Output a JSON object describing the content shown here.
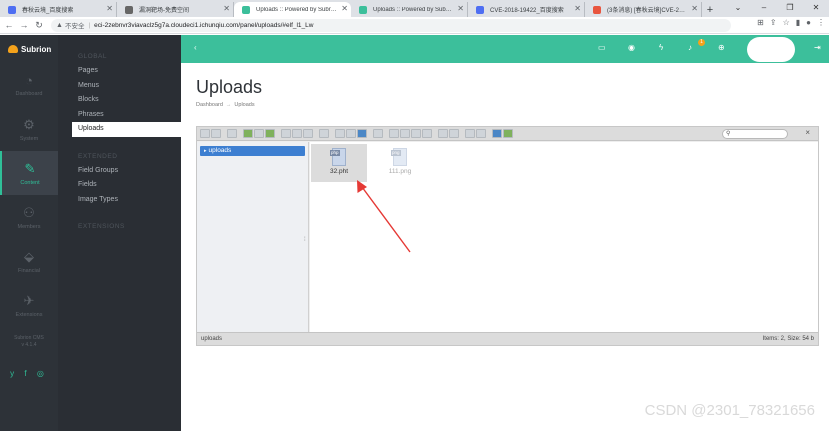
{
  "browser": {
    "tabs": [
      {
        "label": "春秋云境_百度搜索",
        "favicon_color": "#4e6ef2",
        "active": false
      },
      {
        "label": "漏洞靶场-免费空间",
        "favicon_color": "#666666",
        "active": false
      },
      {
        "label": "Uploads :: Powered by Subrion",
        "favicon_color": "#3cbf9b",
        "active": true
      },
      {
        "label": "Uploads :: Powered by Subrion",
        "favicon_color": "#3cbf9b",
        "active": false
      },
      {
        "label": "CVE-2018-19422_百度搜索",
        "favicon_color": "#4e6ef2",
        "active": false
      },
      {
        "label": "(3条消息) [春秋云境]CVE-2018-...",
        "favicon_color": "#e8553e",
        "active": false
      }
    ],
    "insecure_label": "不安全",
    "url": "eci-2zebnvr3viavaclz5g7a.cloudeci1.ichunqiu.com/panel/uploads/#elf_l1_Lw"
  },
  "app": {
    "logo_text": "Subrion",
    "iconbar": [
      {
        "label": "Dashboard",
        "icon": "gauge-icon",
        "glyph": "◔"
      },
      {
        "label": "System",
        "icon": "gear-icon",
        "glyph": "⚙"
      },
      {
        "label": "Content",
        "icon": "pencil-icon",
        "glyph": "✎"
      },
      {
        "label": "Members",
        "icon": "user-icon",
        "glyph": "⚇"
      },
      {
        "label": "Financial",
        "icon": "tag-icon",
        "glyph": "⬙"
      },
      {
        "label": "Extensions",
        "icon": "plug-icon",
        "glyph": "✈"
      }
    ],
    "cms_name": "Subrion CMS",
    "cms_version": "v 4.1.4",
    "socials": "y f ◎",
    "subnav": {
      "global_head": "GLOBAL",
      "global_items": [
        "Pages",
        "Menus",
        "Blocks",
        "Phrases",
        "Uploads"
      ],
      "extended_head": "EXTENDED",
      "extended_items": [
        "Field Groups",
        "Fields",
        "Image Types"
      ],
      "extensions_head": "EXTENSIONS"
    },
    "notification_count": "1"
  },
  "page": {
    "title": "Uploads",
    "breadcrumb_home": "Dashboard",
    "breadcrumb_arrow": "→",
    "breadcrumb_current": "Uploads"
  },
  "file_manager": {
    "tree_root": "uploads",
    "files": [
      {
        "name": "32.pht",
        "tag": "php",
        "selected": true
      },
      {
        "name": "111.png",
        "tag": "png",
        "selected": false
      }
    ],
    "status_path": "uploads",
    "status_info": "Items: 2, Size: 54 b"
  },
  "watermark": "CSDN @2301_78321656",
  "colors": {
    "accent": "#3cbf9b",
    "sidebar": "#2d3238",
    "annotation": "#e53935"
  }
}
